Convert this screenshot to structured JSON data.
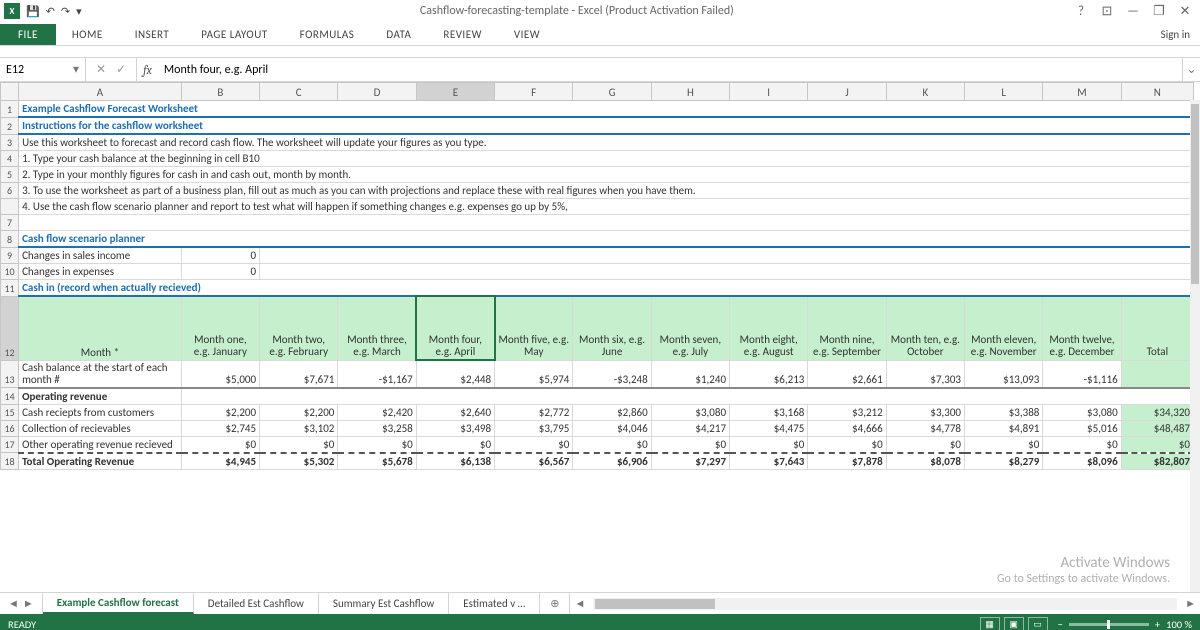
{
  "window": {
    "title": "Cashflow-forecasting-template - Excel (Product Activation Failed)",
    "sign_in": "Sign in"
  },
  "qa_icons": {
    "save": "💾",
    "undo": "↶",
    "redo": "↷"
  },
  "ribbon": {
    "file": "FILE",
    "home": "HOME",
    "insert": "INSERT",
    "page_layout": "PAGE LAYOUT",
    "formulas": "FORMULAS",
    "data": "DATA",
    "review": "REVIEW",
    "view": "VIEW"
  },
  "formula_bar": {
    "cell_ref": "E12",
    "fx": "fx",
    "value": "Month four, e.g. April"
  },
  "columns": [
    "A",
    "B",
    "C",
    "D",
    "E",
    "F",
    "G",
    "H",
    "I",
    "J",
    "K",
    "L",
    "M",
    "N"
  ],
  "rows": {
    "r1": {
      "title": "Example Cashflow Forecast Worksheet"
    },
    "r2": {
      "title": "Instructions for the cashflow worksheet"
    },
    "r3": "Use this worksheet to forecast and record cash flow. The worksheet will update your figures as you type.",
    "r4": "1. Type your cash balance at the beginning in cell B10",
    "r5": "2. Type in your monthly figures for cash in and cash out, month by month.",
    "r6": "3. To use the worksheet as part of a business plan, fill out as much as you can with projections and replace these with real figures when you have them.",
    "r7": "4. Use the cash flow scenario planner and report to test what will happen if something changes e.g. expenses go up by 5%,",
    "r8": {
      "title": "Cash flow scenario planner"
    },
    "r9": {
      "label": "Changes in sales income",
      "val": "0"
    },
    "r10": {
      "label": "Changes in expenses",
      "val": "0"
    },
    "r11": {
      "title": "Cash in (record when actually recieved)"
    },
    "r12": [
      "Month *",
      "Month one, e.g. January",
      "Month two, e.g. February",
      "Month three, e.g. March",
      "Month four, e.g. April",
      "Month five, e.g. May",
      "Month six, e.g. June",
      "Month seven, e.g. July",
      "Month eight, e.g. August",
      "Month nine, e.g. September",
      "Month ten, e.g. October",
      "Month eleven, e.g. November",
      "Month twelve, e.g. December",
      "Total"
    ],
    "r13": {
      "label": "Cash balance at the start of each month #",
      "vals": [
        "$5,000",
        "$7,671",
        "-$1,167",
        "$2,448",
        "$5,974",
        "-$3,248",
        "$1,240",
        "$6,213",
        "$2,661",
        "$7,303",
        "$13,093",
        "-$1,116",
        ""
      ]
    },
    "r14": {
      "label": "Operating revenue"
    },
    "r15": {
      "label": "Cash reciepts from customers",
      "vals": [
        "$2,200",
        "$2,200",
        "$2,420",
        "$2,640",
        "$2,772",
        "$2,860",
        "$3,080",
        "$3,168",
        "$3,212",
        "$3,300",
        "$3,388",
        "$3,080",
        "$34,320"
      ]
    },
    "r16": {
      "label": "Collection of recievables",
      "vals": [
        "$2,745",
        "$3,102",
        "$3,258",
        "$3,498",
        "$3,795",
        "$4,046",
        "$4,217",
        "$4,475",
        "$4,666",
        "$4,778",
        "$4,891",
        "$5,016",
        "$48,487"
      ]
    },
    "r17": {
      "label": "Other operating revenue recieved",
      "vals": [
        "$0",
        "$0",
        "$0",
        "$0",
        "$0",
        "$0",
        "$0",
        "$0",
        "$0",
        "$0",
        "$0",
        "$0",
        "$0"
      ]
    },
    "r18": {
      "label": "Total Operating Revenue",
      "vals": [
        "$4,945",
        "$5,302",
        "$5,678",
        "$6,138",
        "$6,567",
        "$6,906",
        "$7,297",
        "$7,643",
        "$7,878",
        "$8,078",
        "$8,279",
        "$8,096",
        "$82,807"
      ]
    }
  },
  "sheet_tabs": {
    "active": "Example Cashflow forecast",
    "t2": "Detailed Est Cashflow",
    "t3": "Summary Est Cashflow",
    "t4": "Estimated v …"
  },
  "statusbar": {
    "ready": "READY",
    "zoom": "100 %"
  },
  "watermark": {
    "l1": "Activate Windows",
    "l2": "Go to Settings to activate Windows."
  }
}
